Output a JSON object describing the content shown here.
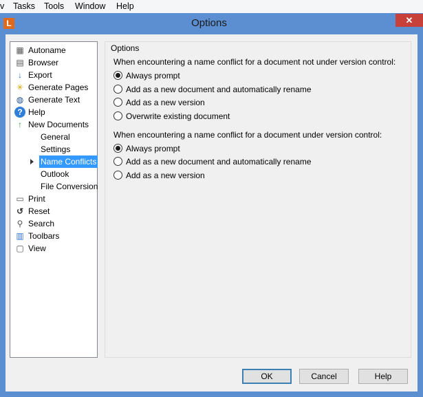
{
  "menubar": {
    "items": [
      {
        "label": "v"
      },
      {
        "label": "Tasks"
      },
      {
        "label": "Tools"
      },
      {
        "label": "Window"
      },
      {
        "label": "Help"
      }
    ]
  },
  "window": {
    "app_icon": "L",
    "title": "Options",
    "close_glyph": "✕"
  },
  "nav": {
    "items": [
      {
        "label": "Autoname",
        "icon": "autoname-icon",
        "glyph": "▦"
      },
      {
        "label": "Browser",
        "icon": "browser-icon",
        "glyph": "▤"
      },
      {
        "label": "Export",
        "icon": "export-icon",
        "glyph": "↓"
      },
      {
        "label": "Generate Pages",
        "icon": "generate-pages-icon",
        "glyph": "✳"
      },
      {
        "label": "Generate Text",
        "icon": "generate-text-icon",
        "glyph": "◍"
      },
      {
        "label": "Help",
        "icon": "help-icon",
        "glyph": "?"
      },
      {
        "label": "New Documents",
        "icon": "new-documents-icon",
        "glyph": "↑"
      },
      {
        "label": "Print",
        "icon": "print-icon",
        "glyph": "▭"
      },
      {
        "label": "Reset",
        "icon": "reset-icon",
        "glyph": "↺"
      },
      {
        "label": "Search",
        "icon": "search-icon",
        "glyph": "⚲"
      },
      {
        "label": "Toolbars",
        "icon": "toolbars-icon",
        "glyph": "▥"
      },
      {
        "label": "View",
        "icon": "view-icon",
        "glyph": "▢"
      }
    ],
    "sub_items": [
      {
        "label": "General"
      },
      {
        "label": "Settings"
      },
      {
        "label": "Name Conflicts",
        "selected": true
      },
      {
        "label": "Outlook"
      },
      {
        "label": "File Conversion"
      }
    ]
  },
  "options": {
    "group_title": "Options",
    "q1": "When encountering a name conflict for a document not under version control:",
    "q1_options": [
      {
        "label": "Always prompt",
        "checked": true
      },
      {
        "label": "Add as a new document and automatically rename",
        "checked": false
      },
      {
        "label": "Add as a new version",
        "checked": false
      },
      {
        "label": "Overwrite existing document",
        "checked": false
      }
    ],
    "q2": "When encountering a name conflict for a document under version control:",
    "q2_options": [
      {
        "label": "Always prompt",
        "checked": true
      },
      {
        "label": "Add as a new document and automatically rename",
        "checked": false
      },
      {
        "label": "Add as a new version",
        "checked": false
      }
    ]
  },
  "buttons": {
    "ok": "OK",
    "cancel": "Cancel",
    "help": "Help"
  }
}
